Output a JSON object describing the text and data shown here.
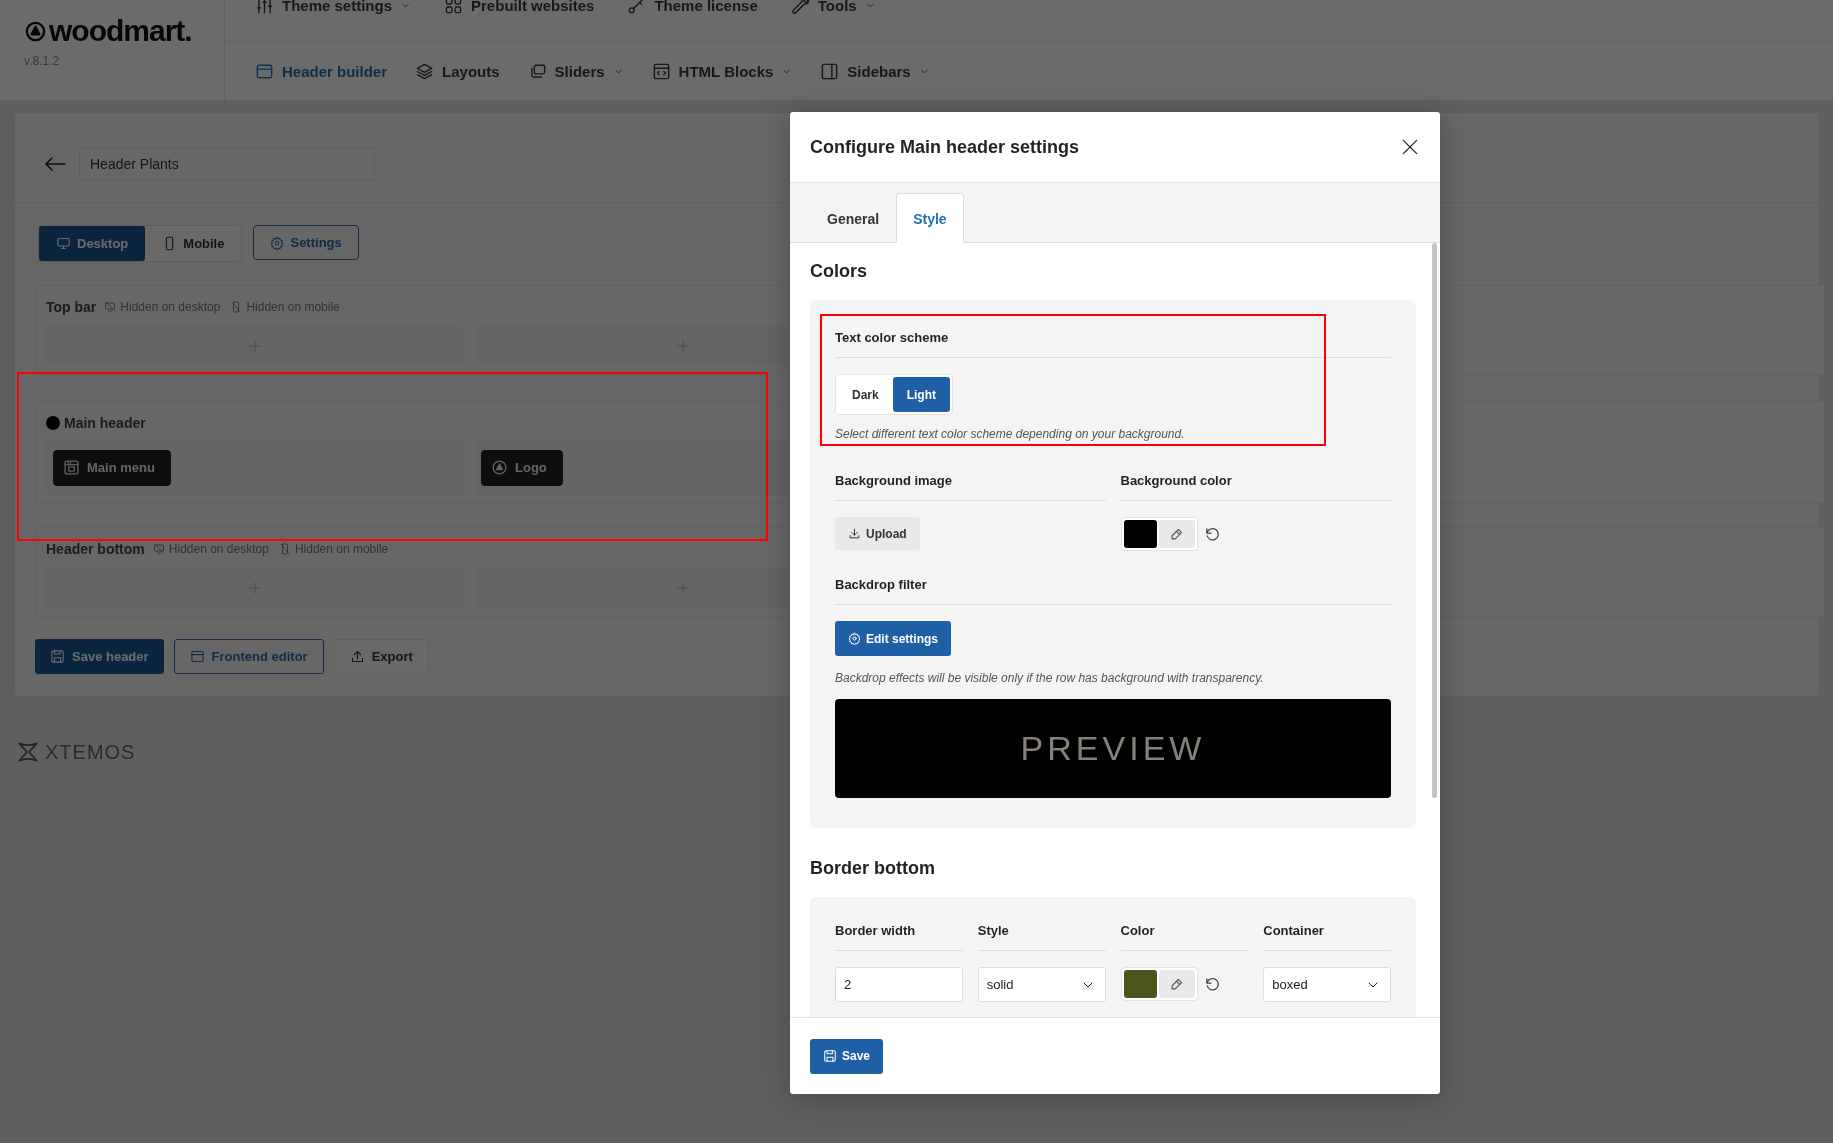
{
  "brand": {
    "logo": "woodmart.",
    "version": "v.8.1.2"
  },
  "top_menu": [
    {
      "label": "Theme settings",
      "dropdown": true
    },
    {
      "label": "Prebuilt websites",
      "dropdown": false
    },
    {
      "label": "Theme license",
      "dropdown": false
    },
    {
      "label": "Tools",
      "dropdown": true
    }
  ],
  "sub_menu": [
    {
      "label": "Header builder",
      "selected": true,
      "dropdown": false
    },
    {
      "label": "Layouts",
      "selected": false,
      "dropdown": false
    },
    {
      "label": "Sliders",
      "selected": false,
      "dropdown": true
    },
    {
      "label": "HTML Blocks",
      "selected": false,
      "dropdown": true
    },
    {
      "label": "Sidebars",
      "selected": false,
      "dropdown": true
    }
  ],
  "builder": {
    "header_name": "Header Plants",
    "devices": [
      {
        "label": "Desktop",
        "selected": true
      },
      {
        "label": "Mobile",
        "selected": false
      }
    ],
    "settings_button": "Settings",
    "rows": [
      {
        "name": "Top bar",
        "editing": false,
        "highlighted": false,
        "notes": [
          "Hidden on desktop",
          "Hidden on mobile"
        ]
      },
      {
        "name": "Main header",
        "editing": true,
        "highlighted": true,
        "elements": [
          {
            "label": "Main menu",
            "kind": "menu"
          },
          {
            "label": "Logo",
            "kind": "logo"
          }
        ]
      },
      {
        "name": "Header bottom",
        "editing": false,
        "highlighted": false,
        "notes": [
          "Hidden on desktop",
          "Hidden on mobile"
        ]
      }
    ],
    "actions": [
      {
        "label": "Save header",
        "kind": "primary"
      },
      {
        "label": "Frontend editor",
        "kind": "outline"
      },
      {
        "label": "Export",
        "kind": "plain"
      }
    ]
  },
  "footer_logo": "XTEMOS",
  "modal": {
    "title": "Configure Main header settings",
    "tabs": [
      {
        "label": "General",
        "selected": false
      },
      {
        "label": "Style",
        "selected": true
      }
    ],
    "colors": {
      "heading": "Colors",
      "text_scheme": {
        "label": "Text color scheme",
        "highlighted": true,
        "options": [
          {
            "label": "Dark",
            "selected": false
          },
          {
            "label": "Light",
            "selected": true
          }
        ],
        "hint": "Select different text color scheme depending on your background."
      },
      "background_image": {
        "label": "Background image",
        "button": "Upload"
      },
      "background_color": {
        "label": "Background color",
        "color": "#000000"
      },
      "backdrop": {
        "label": "Backdrop filter",
        "button": "Edit settings",
        "hint": "Backdrop effects will be visible only if the row has background with transparency.",
        "preview": "PREVIEW"
      }
    },
    "border_bottom": {
      "heading": "Border bottom",
      "width": {
        "label": "Border width",
        "value": "2"
      },
      "style": {
        "label": "Style",
        "value": "solid"
      },
      "color": {
        "label": "Color",
        "color": "#4a561c"
      },
      "container": {
        "label": "Container",
        "value": "boxed"
      }
    },
    "save_button": "Save"
  }
}
